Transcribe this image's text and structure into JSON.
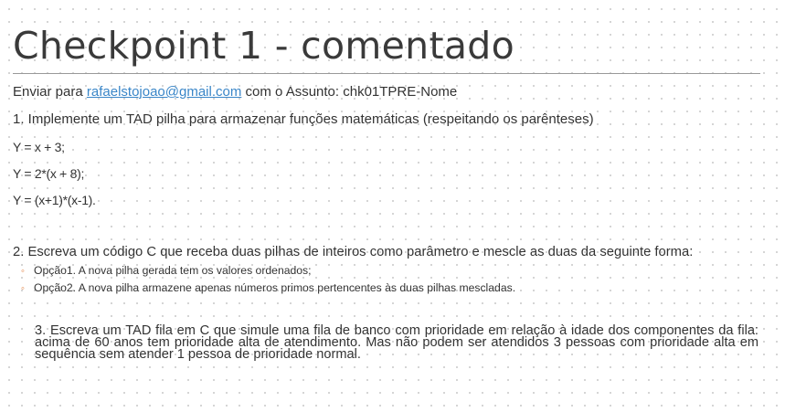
{
  "slide": {
    "title": "Checkpoint 1 -  comentado",
    "send": {
      "prefix": "Enviar para ",
      "email": "rafaelstojoao@gmail.com",
      "suffix": " com o Assunto:  chk01TPRE-Nome"
    },
    "q1": {
      "text": "1. Implemente um TAD pilha para armazenar funções matemáticas (respeitando os parênteses)",
      "examples": [
        "Y = x + 3;",
        "Y = 2*(x + 8);",
        "Y = (x+1)*(x-1)."
      ]
    },
    "q2": {
      "text": "2. Escreva um código C que receba duas pilhas de inteiros como parâmetro e mescle as duas da seguinte forma:",
      "options": [
        "Opção1. A nova pilha gerada tem os valores ordenados;",
        "Opção2. A nova pilha armazene apenas números primos pertencentes às duas pilhas mescladas."
      ],
      "bullet_glyph": "◦"
    },
    "q3": {
      "text": "3. Escreva um TAD fila em C que simule uma fila de banco com prioridade em relação à idade dos componentes da fila:  acima de 60 anos tem prioridade alta de atendimento. Mas não podem ser atendidos 3 pessoas com prioridade alta em sequência sem atender 1 pessoa de prioridade normal."
    }
  },
  "colors": {
    "text": "#333333",
    "link": "#3a86c8",
    "bullet": "#e07b39",
    "rule": "#999999",
    "grid_dots": "#c9c9c9"
  }
}
